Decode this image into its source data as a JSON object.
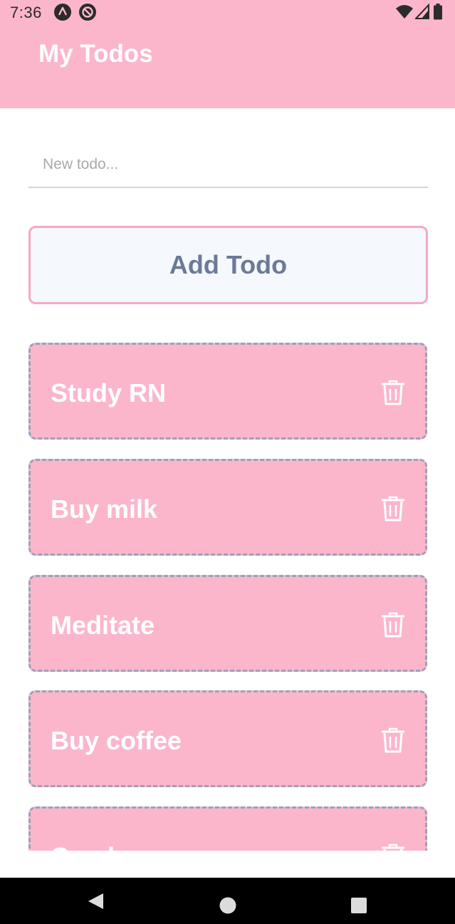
{
  "status_bar": {
    "time": "7:36"
  },
  "header": {
    "title": "My Todos",
    "background": "#fbb6cc"
  },
  "input": {
    "placeholder": "New todo...",
    "value": ""
  },
  "add_button": {
    "label": "Add Todo"
  },
  "todos": [
    {
      "text": "Study RN",
      "delete_icon": "trash-icon"
    },
    {
      "text": "Buy milk",
      "delete_icon": "trash-icon"
    },
    {
      "text": "Meditate",
      "delete_icon": "trash-icon"
    },
    {
      "text": "Buy coffee",
      "delete_icon": "trash-icon"
    },
    {
      "text": "Crack",
      "delete_icon": "trash-icon"
    }
  ],
  "colors": {
    "accent_pink": "#fbb6cc",
    "button_text": "#6b7a96",
    "dashed_border": "#98a3b8"
  },
  "nav_bar": {
    "icons": [
      "back-icon",
      "home-icon",
      "recents-icon"
    ]
  }
}
